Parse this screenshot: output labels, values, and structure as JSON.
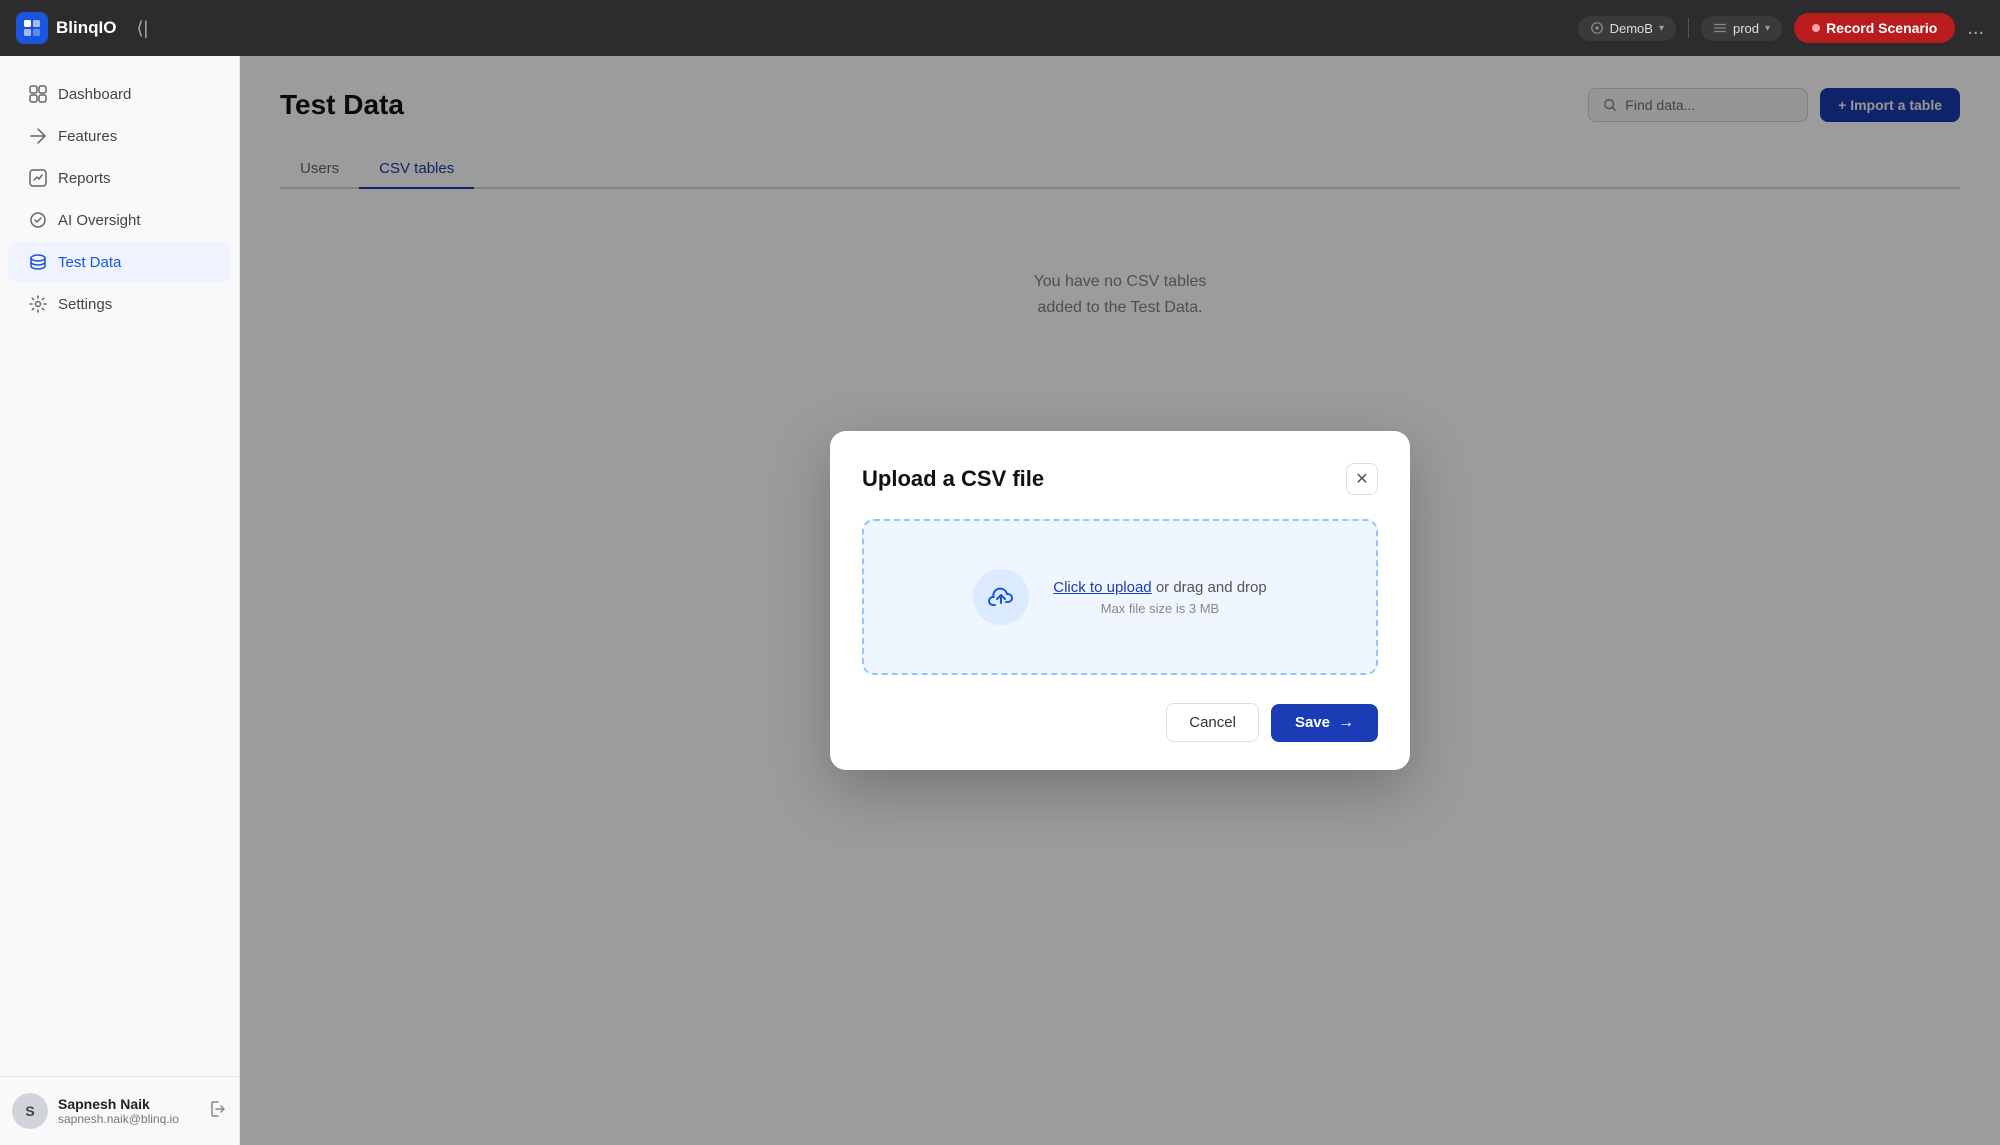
{
  "app": {
    "logo_text": "BlinqIO",
    "collapse_label": "Collapse sidebar"
  },
  "topbar": {
    "demo_label": "DemoB",
    "env_label": "prod",
    "record_label": "Record Scenario",
    "more_label": "..."
  },
  "sidebar": {
    "items": [
      {
        "id": "dashboard",
        "label": "Dashboard"
      },
      {
        "id": "features",
        "label": "Features"
      },
      {
        "id": "reports",
        "label": "Reports"
      },
      {
        "id": "ai-oversight",
        "label": "AI Oversight"
      },
      {
        "id": "test-data",
        "label": "Test Data"
      },
      {
        "id": "settings",
        "label": "Settings"
      }
    ],
    "active": "test-data",
    "user": {
      "initials": "S",
      "name": "Sapnesh Naik",
      "email": "sapnesh.naik@blinq.io"
    }
  },
  "content": {
    "page_title": "Test Data",
    "search_placeholder": "Find data...",
    "import_label": "+ Import a table",
    "tabs": [
      {
        "id": "users",
        "label": "Users"
      },
      {
        "id": "csv-tables",
        "label": "CSV tables"
      }
    ],
    "active_tab": "csv-tables",
    "empty_state_line1": "You have no CSV tables",
    "empty_state_line2": "added to the Test Data."
  },
  "modal": {
    "title": "Upload a CSV file",
    "close_label": "✕",
    "drop_click_label": "Click to upload",
    "drop_or_label": " or drag and drop",
    "file_size_label": "Max file size is 3 MB",
    "cancel_label": "Cancel",
    "save_label": "Save",
    "save_arrow": "→"
  }
}
